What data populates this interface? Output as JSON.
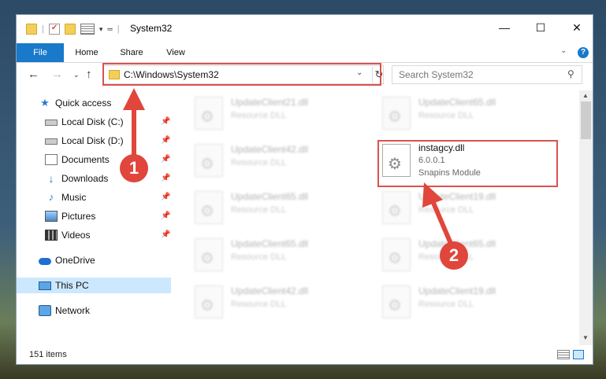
{
  "window": {
    "title": "System32",
    "minimize_label": "—",
    "maximize_label": "☐",
    "close_label": "✕"
  },
  "ribbon": {
    "tabs": [
      "File",
      "Home",
      "Share",
      "View"
    ],
    "accent": "#1979ca"
  },
  "navigation": {
    "address": "C:\\Windows\\System32",
    "search_placeholder": "Search System32"
  },
  "sidebar": {
    "items": [
      {
        "label": "Quick access",
        "icon": "star-icon"
      },
      {
        "label": "Local Disk (C:)",
        "icon": "drive-icon"
      },
      {
        "label": "Local Disk (D:)",
        "icon": "drive-icon"
      },
      {
        "label": "Documents",
        "icon": "document-icon"
      },
      {
        "label": "Downloads",
        "icon": "download-icon"
      },
      {
        "label": "Music",
        "icon": "music-icon"
      },
      {
        "label": "Pictures",
        "icon": "pictures-icon"
      },
      {
        "label": "Videos",
        "icon": "videos-icon"
      },
      {
        "label": "OneDrive",
        "icon": "cloud-icon"
      },
      {
        "label": "This PC",
        "icon": "computer-icon"
      },
      {
        "label": "Network",
        "icon": "network-icon"
      }
    ]
  },
  "files": [
    {
      "name": "UpdateClient21.dll",
      "type": "Resource DLL"
    },
    {
      "name": "UpdateClient65.dll",
      "type": "Resource DLL"
    },
    {
      "name": "UpdateClient42.dll",
      "type": "Resource DLL"
    },
    {
      "name": "instagcy.dll",
      "version": "6.0.0.1",
      "type": "Snapins Module"
    },
    {
      "name": "UpdateClient65.dll",
      "type": "Resource DLL"
    },
    {
      "name": "UpdateClient19.dll",
      "type": "Resource DLL"
    },
    {
      "name": "UpdateClient65.dll",
      "type": "Resource DLL"
    },
    {
      "name": "UpdateClient65.dll",
      "type": "Resource DLL"
    },
    {
      "name": "UpdateClient42.dll",
      "type": "Resource DLL"
    },
    {
      "name": "UpdateClient19.dll",
      "type": "Resource DLL"
    }
  ],
  "status": {
    "item_count": "151 items"
  },
  "annotations": {
    "callout_1": "1",
    "callout_2": "2",
    "color": "#e0463b"
  }
}
